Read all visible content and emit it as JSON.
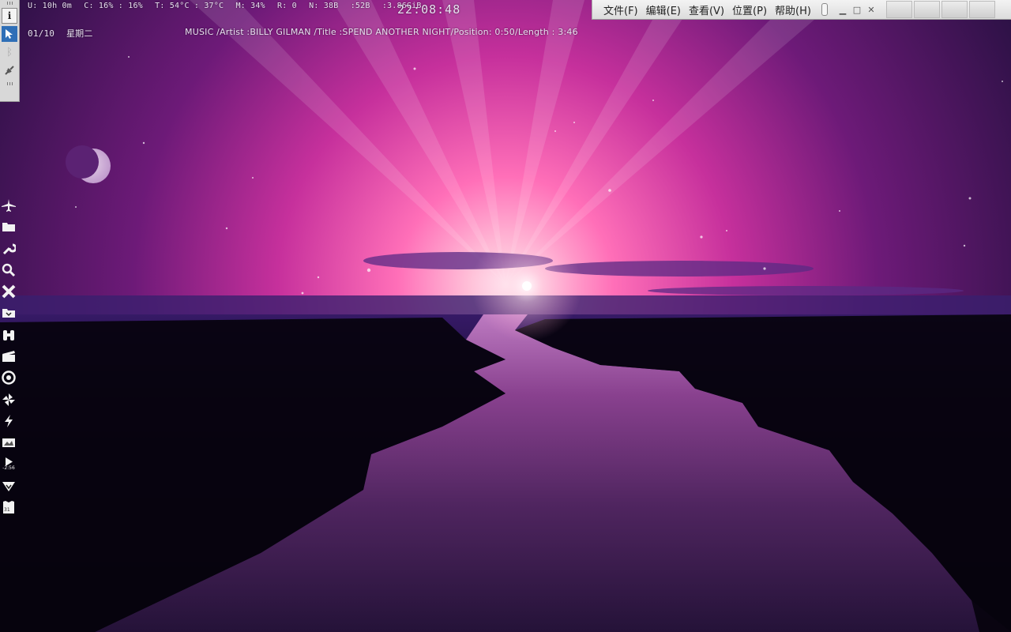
{
  "conky": {
    "stats": [
      "U: 10h 0m",
      "C: 16% : 16%",
      "T: 54°C : 37°C",
      "M: 34%",
      "R: 0",
      "N: 38B",
      ":52B",
      ":3.86GiB"
    ],
    "clock": "22:08:48",
    "date": "01/10",
    "weekday": "星期二",
    "music": "MUSIC /Artist :BILLY GILMAN /Title :SPEND ANOTHER NIGHT/Position: 0:50/Length   : 3:46"
  },
  "tray": {
    "icons": [
      "info-icon",
      "cursor-icon",
      "bluetooth-icon",
      "network-plug-icon"
    ],
    "info_glyph": "i",
    "bluetooth_glyph": "ᛒ"
  },
  "menubar": {
    "items": [
      "文件(F)",
      "编辑(E)",
      "查看(V)",
      "位置(P)",
      "帮助(H)"
    ],
    "minimize_glyph": "▁",
    "maximize_glyph": "□",
    "close_glyph": "✕"
  },
  "launcher": {
    "icons": [
      "airplane-icon",
      "folder-icon",
      "wrench-icon",
      "search-icon",
      "x-tool-icon",
      "file-manager-icon",
      "binoculars-icon",
      "clapper-icon",
      "chrome-icon",
      "pinwheel-icon",
      "lightning-icon",
      "photo-icon",
      "media-player-icon",
      "download-icon",
      "calendar-icon"
    ],
    "media_time": "-2:56",
    "calendar_day": "31"
  },
  "colors": {
    "sky_top": "#2b0f4d",
    "sky_glow": "#ff6fb8",
    "horizon": "#ffd0e4",
    "land": "#06030d",
    "river": "#8a3f8f"
  }
}
